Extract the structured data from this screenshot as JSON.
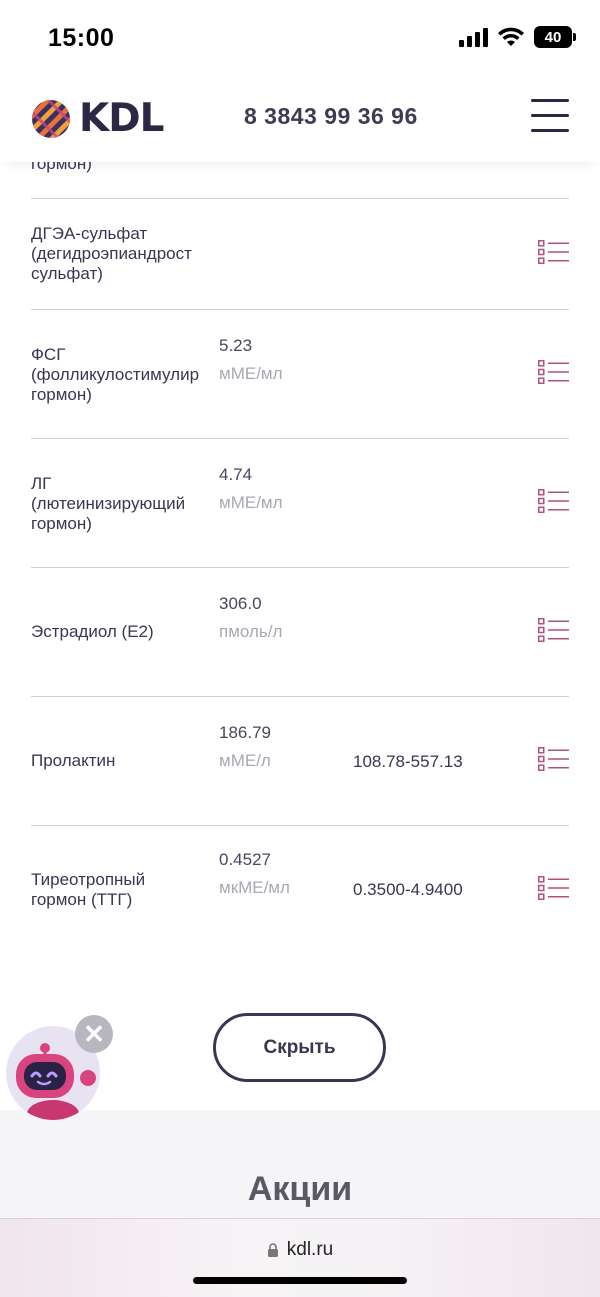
{
  "status_bar": {
    "time": "15:00",
    "battery": "40"
  },
  "header": {
    "brand": "KDL",
    "phone": "8 3843 99 36 96"
  },
  "results": [
    {
      "name": "гормон)",
      "value": "",
      "unit": "",
      "norm": ""
    },
    {
      "name": "ДГЭА-сульфат\n(дегидроэпиандрост\nсульфат)",
      "value": "",
      "unit": "",
      "norm": ""
    },
    {
      "name": "ФСГ\n(фолликулостимулир\nгормон)",
      "value": "5.23",
      "unit": "мМЕ/мл",
      "norm": ""
    },
    {
      "name": "ЛГ\n(лютеинизирующий\nгормон)",
      "value": "4.74",
      "unit": "мМЕ/мл",
      "norm": ""
    },
    {
      "name": "Эстрадиол (Е2)",
      "value": "306.0",
      "unit": "пмоль/л",
      "norm": ""
    },
    {
      "name": "Пролактин",
      "value": "186.79",
      "unit": "мМЕ/л",
      "norm": "108.78-557.13"
    },
    {
      "name": "Тиреотропный\nгормон (ТТГ)",
      "value": "0.4527",
      "unit": "мкМЕ/мл",
      "norm": "0.3500-4.9400"
    }
  ],
  "hide_button": {
    "label": "Скрыть"
  },
  "bot": {
    "close_symbol": "✕"
  },
  "promo": {
    "title": "Акции"
  },
  "browser": {
    "url": "kdl.ru"
  },
  "colors": {
    "accent": "#b0517e",
    "text": "#3a3553",
    "muted": "#a9a7b4"
  }
}
